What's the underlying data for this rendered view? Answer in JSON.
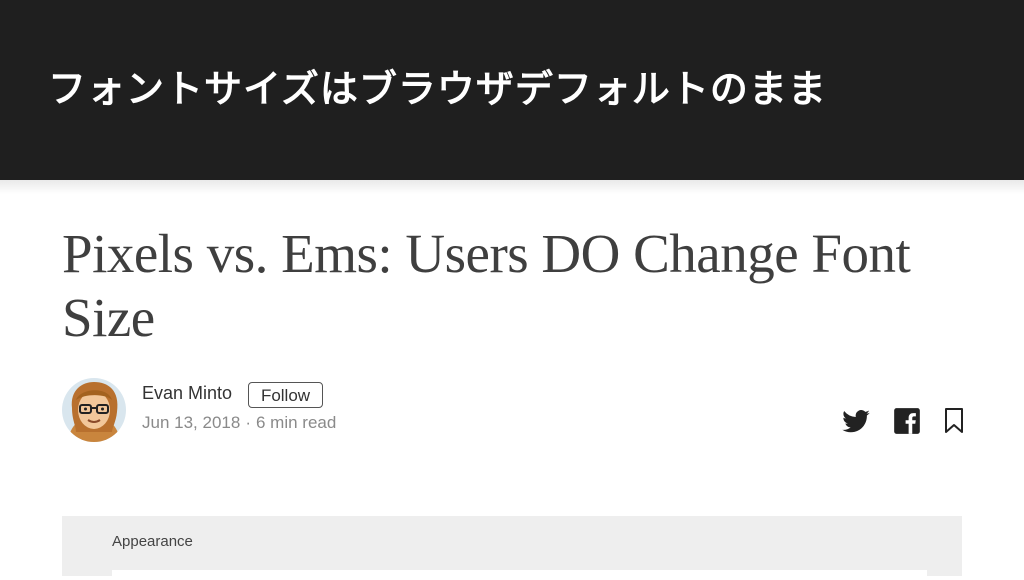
{
  "banner": {
    "title": "フォントサイズはブラウザデフォルトのまま"
  },
  "article": {
    "title": "Pixels vs. Ems: Users DO Change Font Size",
    "author": {
      "name": "Evan Minto",
      "follow_label": "Follow",
      "date": "Jun 13, 2018",
      "separator": "·",
      "read_time": "6 min read"
    },
    "share_icons": [
      "twitter-icon",
      "facebook-icon",
      "bookmark-icon"
    ]
  },
  "appearance": {
    "label": "Appearance"
  },
  "colors": {
    "banner_bg": "#1f1f1f",
    "title_text": "#3f3f3f",
    "panel_bg": "#eeeeee"
  }
}
